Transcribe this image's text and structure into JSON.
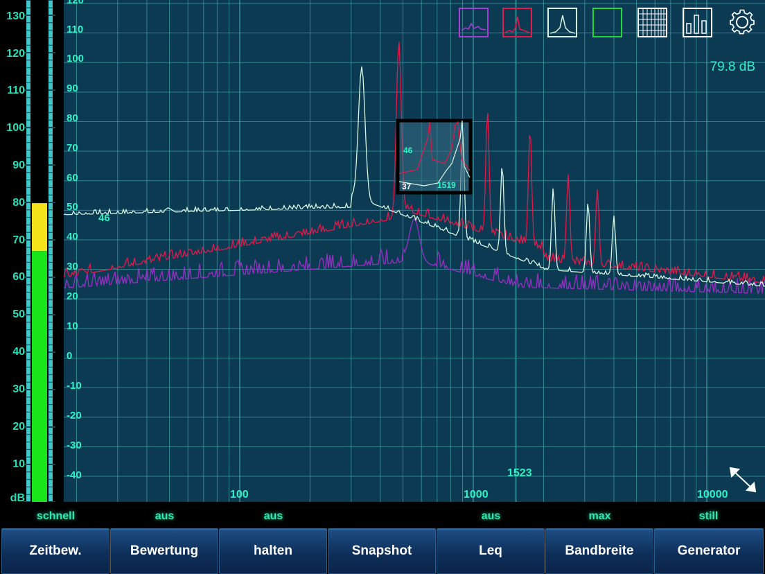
{
  "meter": {
    "labels": [
      "130",
      "120",
      "110",
      "100",
      "90",
      "80",
      "70",
      "60",
      "50",
      "40",
      "30",
      "20",
      "10"
    ],
    "unit": "dB",
    "level_db": 79.8,
    "colors": {
      "green": "#19e51b",
      "yellow": "#f4e21b",
      "track": "#43c6c8"
    }
  },
  "plot": {
    "y_labels": [
      "120",
      "110",
      "100",
      "90",
      "80",
      "70",
      "60",
      "50",
      "40",
      "30",
      "20",
      "10",
      "0",
      "-10",
      "-20",
      "-30",
      "-40"
    ],
    "x_labels": [
      "100",
      "1000",
      "10000"
    ],
    "cursor_freq": "1523",
    "marker_value": "46",
    "level_readout": "79.8 dB",
    "zoom_box": {
      "label_top": "46",
      "label_left": "37",
      "label_right": "1519"
    },
    "colors": {
      "background": "#0b3a52",
      "grid": "#3ea7a8",
      "white_trace": "#d8f7e4",
      "red_trace": "#e5194a",
      "purple_trace": "#9a2fc7"
    }
  },
  "toolbar_icons": [
    "purple-spectrum-icon",
    "red-spectrum-icon",
    "white-spectrum-icon",
    "green-box-icon",
    "grid-icon",
    "bar-chart-icon",
    "gear-icon"
  ],
  "status": [
    "schnell",
    "aus",
    "aus",
    "",
    "aus",
    "max",
    "still"
  ],
  "buttons": [
    "Zeitbew.",
    "Bewertung",
    "halten",
    "Snapshot",
    "Leq",
    "Bandbreite",
    "Generator"
  ]
}
